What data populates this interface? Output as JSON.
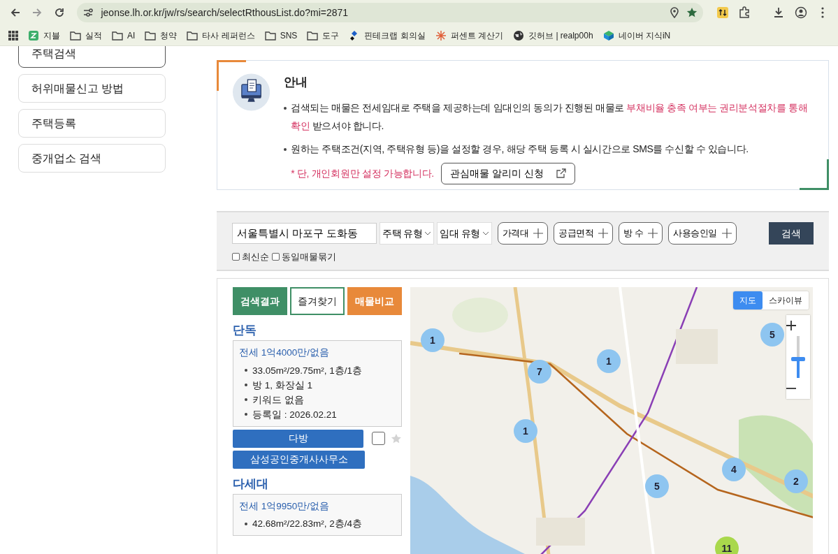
{
  "browser": {
    "url": "jeonse.lh.or.kr/jw/rs/search/selectRthousList.do?mi=2871",
    "bookmarked": true,
    "bookmarks": [
      {
        "label": "지블",
        "kind": "app"
      },
      {
        "label": "실적",
        "kind": "folder"
      },
      {
        "label": "AI",
        "kind": "folder"
      },
      {
        "label": "청약",
        "kind": "folder"
      },
      {
        "label": "타사 레퍼런스",
        "kind": "folder"
      },
      {
        "label": "SNS",
        "kind": "folder"
      },
      {
        "label": "도구",
        "kind": "folder"
      },
      {
        "label": "핀테크랩 회의실",
        "kind": "diamond"
      },
      {
        "label": "퍼센트 계산기",
        "kind": "burst"
      },
      {
        "label": "깃허브 | realp00h",
        "kind": "globe"
      },
      {
        "label": "네이버 지식iN",
        "kind": "cube"
      }
    ]
  },
  "sidebar": {
    "items": [
      {
        "label": "주택검색",
        "selected": true
      },
      {
        "label": "허위매물신고 방법",
        "selected": false
      },
      {
        "label": "주택등록",
        "selected": false
      },
      {
        "label": "중개업소 검색",
        "selected": false
      }
    ]
  },
  "notice": {
    "title": "안내",
    "bullets": [
      {
        "segments": [
          {
            "text": "검색되는 매물은 전세임대로 주택을 제공하는데 임대인의 동의가 진행된 매물로 ",
            "highlight": false
          },
          {
            "text": "부채비율 충족 여부는 권리분석절차를 통해 확인",
            "highlight": true
          },
          {
            "text": " 받으셔야 합니다.",
            "highlight": false
          }
        ]
      },
      {
        "segments": [
          {
            "text": "원하는 주택조건(지역, 주택유형 등)을 설정할 경우, 해당 주택 등록 시 실시간으로 SMS를 수신할 수 있습니다.",
            "highlight": false
          }
        ]
      }
    ],
    "note": "* 단, 개인회원만 설정 가능합니다.",
    "alert_button": "관심매물 알리미 신청"
  },
  "search": {
    "location": "서울특별시 마포구 도화동",
    "selects": [
      "주택 유형",
      "임대 유형"
    ],
    "filters": [
      "가격대",
      "공급면적",
      "방 수",
      "사용승인일"
    ],
    "button": "검색",
    "options": [
      {
        "label": "최신순",
        "checked": false
      },
      {
        "label": "동일매물묶기",
        "checked": false
      }
    ]
  },
  "results": {
    "tabs": [
      {
        "label": "검색결과",
        "kind": "filled",
        "color": "#3f8f66"
      },
      {
        "label": "즐겨찾기",
        "kind": "outline",
        "color": "#3f8f66"
      },
      {
        "label": "매물비교",
        "kind": "filled",
        "color": "#e8893a"
      }
    ],
    "listings": [
      {
        "category": "단독",
        "price": "전세 1억4000만/없음",
        "details": [
          "33.05m²/29.75m², 1층/1층",
          "방 1, 화장실 1",
          "키워드 없음",
          "등록일 : 2026.02.21"
        ],
        "agency_buttons": [
          "다방",
          "삼성공인중개사사무소"
        ],
        "compare_checked": false,
        "favorite": false
      },
      {
        "category": "다세대",
        "price": "전세 1억9950만/없음",
        "details": [
          "42.68m²/22.83m², 2층/4층"
        ]
      }
    ]
  },
  "map": {
    "views": [
      {
        "label": "지도",
        "selected": true
      },
      {
        "label": "스카이뷰",
        "selected": false
      }
    ],
    "zoom": {
      "level": 0.45
    },
    "clusters": [
      {
        "count": "1",
        "color": "#8ec5f0"
      },
      {
        "count": "5",
        "color": "#8ec5f0"
      },
      {
        "count": "1",
        "color": "#8ec5f0"
      },
      {
        "count": "7",
        "color": "#8ec5f0"
      },
      {
        "count": "1",
        "color": "#8ec5f0"
      },
      {
        "count": "4",
        "color": "#8ec5f0"
      },
      {
        "count": "5",
        "color": "#8ec5f0"
      },
      {
        "count": "2",
        "color": "#8ec5f0"
      },
      {
        "count": "11",
        "color": "#a9d84c"
      }
    ]
  }
}
